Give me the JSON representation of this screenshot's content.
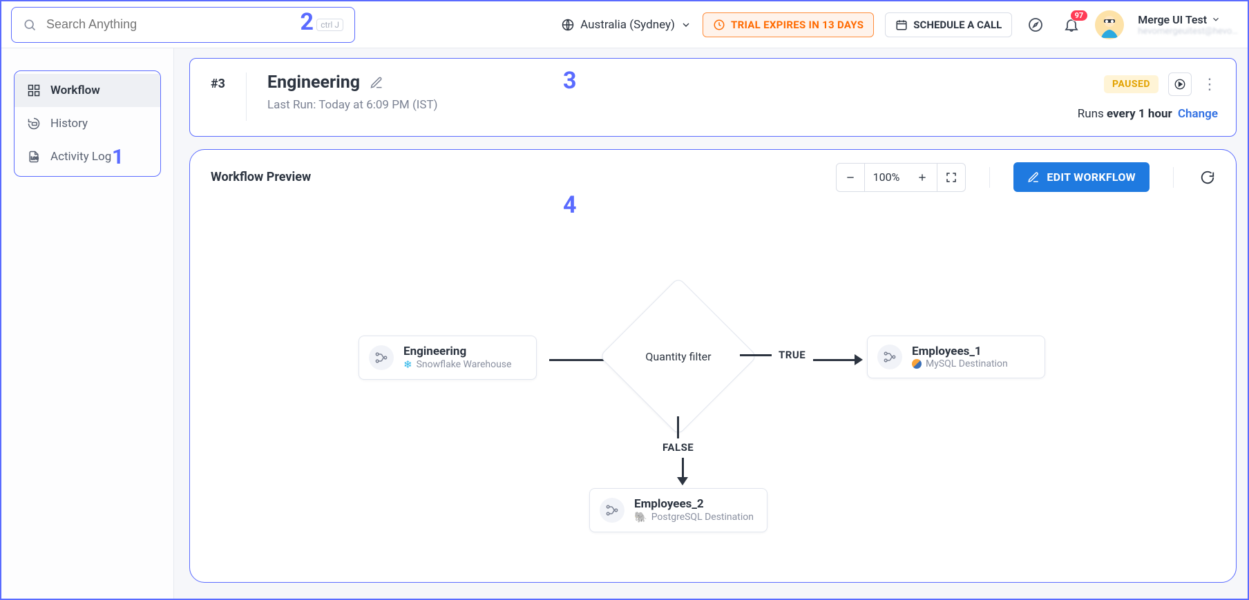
{
  "topbar": {
    "search_placeholder": "Search Anything",
    "search_kbd": "ctrl J",
    "region": "Australia (Sydney)",
    "trial": "TRIAL EXPIRES IN 13 DAYS",
    "schedule": "SCHEDULE A CALL",
    "notif_count": "97",
    "user_name": "Merge UI Test",
    "user_sub": "hevomergeuitest@hevo…"
  },
  "sidebar": {
    "items": [
      {
        "label": "Workflow"
      },
      {
        "label": "History"
      },
      {
        "label": "Activity Log"
      }
    ]
  },
  "annot": {
    "a1": "1",
    "a2": "2",
    "a3": "3",
    "a4": "4"
  },
  "head": {
    "num": "#3",
    "title": "Engineering",
    "last_run": "Last Run: Today at 6:09 PM (IST)",
    "status": "PAUSED",
    "runs_prefix": "Runs ",
    "runs_bold": "every 1 hour",
    "runs_change": "Change"
  },
  "preview": {
    "title": "Workflow Preview",
    "zoom": "100%",
    "edit": "EDIT WORKFLOW"
  },
  "flow": {
    "src": {
      "title": "Engineering",
      "sub": "Snowflake Warehouse"
    },
    "cond": {
      "label": "Quantity filter"
    },
    "dst1": {
      "title": "Employees_1",
      "sub": "MySQL Destination"
    },
    "dst2": {
      "title": "Employees_2",
      "sub": "PostgreSQL Destination"
    },
    "true": "TRUE",
    "false": "FALSE"
  }
}
